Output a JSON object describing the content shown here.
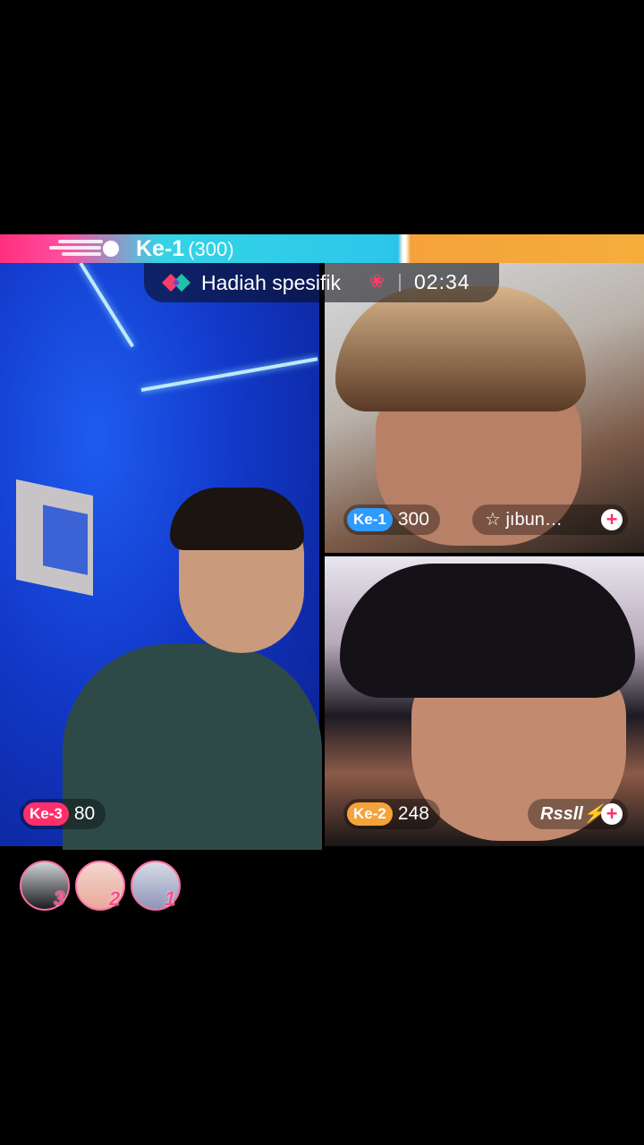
{
  "battle": {
    "leader_rank": "Ke-1",
    "leader_score": "(300)"
  },
  "timer": {
    "label": "Hadiah spesifik",
    "time": "02:34"
  },
  "participants": [
    {
      "slot": "left",
      "rank": "Ke-3",
      "score": "80",
      "color": "#ff2f6a"
    },
    {
      "slot": "top-right",
      "rank": "Ke-1",
      "score": "300",
      "name": "☆ jıbun…",
      "color": "#2f9bff"
    },
    {
      "slot": "bottom-right",
      "rank": "Ke-2",
      "score": "248",
      "name": "Rssll⚡",
      "color": "#f5a23a"
    }
  ],
  "viewers": [
    {
      "rank": "3",
      "avatar": "viewer-avatar"
    },
    {
      "rank": "2",
      "avatar": "viewer-avatar"
    },
    {
      "rank": "1",
      "avatar": "viewer-avatar"
    }
  ],
  "icons": {
    "gift": "gift-icon",
    "rose": "rose-icon",
    "plus": "plus-icon"
  }
}
